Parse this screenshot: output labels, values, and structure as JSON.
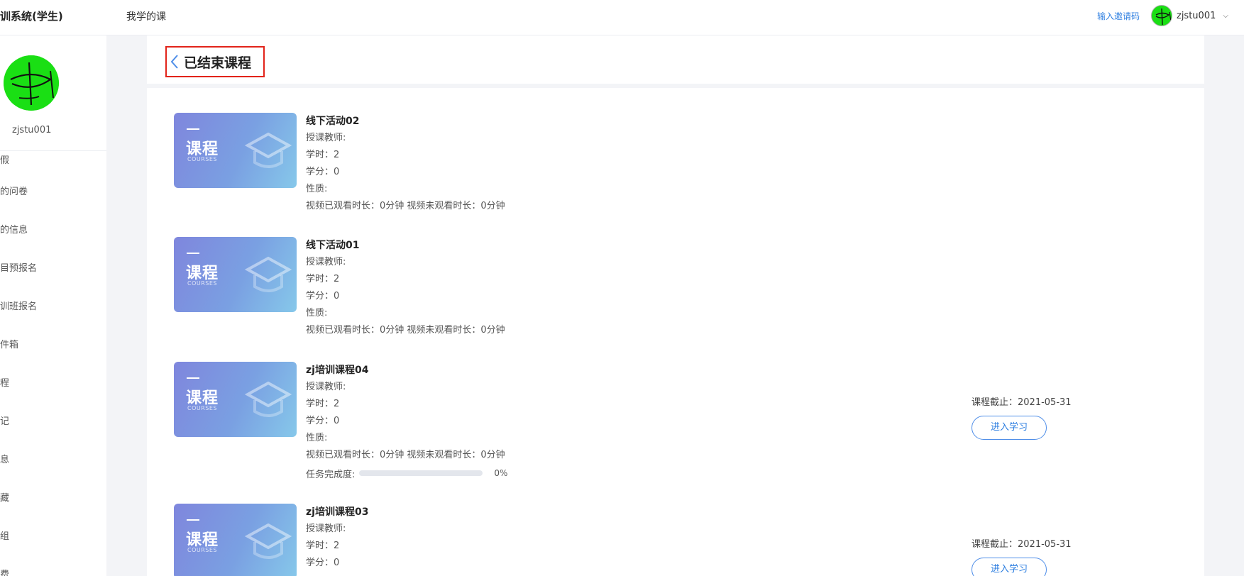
{
  "app": {
    "title": "训系统(学生)",
    "nav_my_courses": "我学的课",
    "invite_code": "输入邀请码",
    "username": "zjstu001"
  },
  "sidebar": {
    "username": "zjstu001",
    "items": [
      {
        "label": "假"
      },
      {
        "label": "的问卷"
      },
      {
        "label": "的信息"
      },
      {
        "label": "目预报名"
      },
      {
        "label": "训班报名"
      },
      {
        "label": "件箱"
      },
      {
        "label": "程"
      },
      {
        "label": "记"
      },
      {
        "label": "息"
      },
      {
        "label": "藏"
      },
      {
        "label": "组"
      },
      {
        "label": "费"
      }
    ]
  },
  "page": {
    "title": "已结束课程"
  },
  "thumbnail": {
    "title": "课程",
    "subtitle": "COURSES"
  },
  "courses": [
    {
      "name": "线下活动02",
      "teacher": "授课教师:",
      "hours": "学时：2",
      "credits": "学分：0",
      "nature": "性质:",
      "video": "视频已观看时长：0分钟 视频未观看时长：0分钟"
    },
    {
      "name": "线下活动01",
      "teacher": "授课教师:",
      "hours": "学时：2",
      "credits": "学分：0",
      "nature": "性质:",
      "video": "视频已观看时长：0分钟 视频未观看时长：0分钟"
    },
    {
      "name": "zj培训课程04",
      "teacher": "授课教师:",
      "hours": "学时：2",
      "credits": "学分：0",
      "nature": "性质:",
      "video": "视频已观看时长：0分钟 视频未观看时长：0分钟",
      "progress_label": "任务完成度:",
      "progress_pct": "0%",
      "progress_value": 0,
      "deadline": "课程截止：2021-05-31",
      "enter_label": "进入学习"
    },
    {
      "name": "zj培训课程03",
      "teacher": "授课教师:",
      "hours": "学时：2",
      "credits": "学分：0",
      "deadline": "课程截止：2021-05-31",
      "enter_label": "进入学习"
    }
  ],
  "colors": {
    "accent": "#2b7de0",
    "highlight_border": "#e2231a",
    "avatar_green": "#1adf14"
  }
}
